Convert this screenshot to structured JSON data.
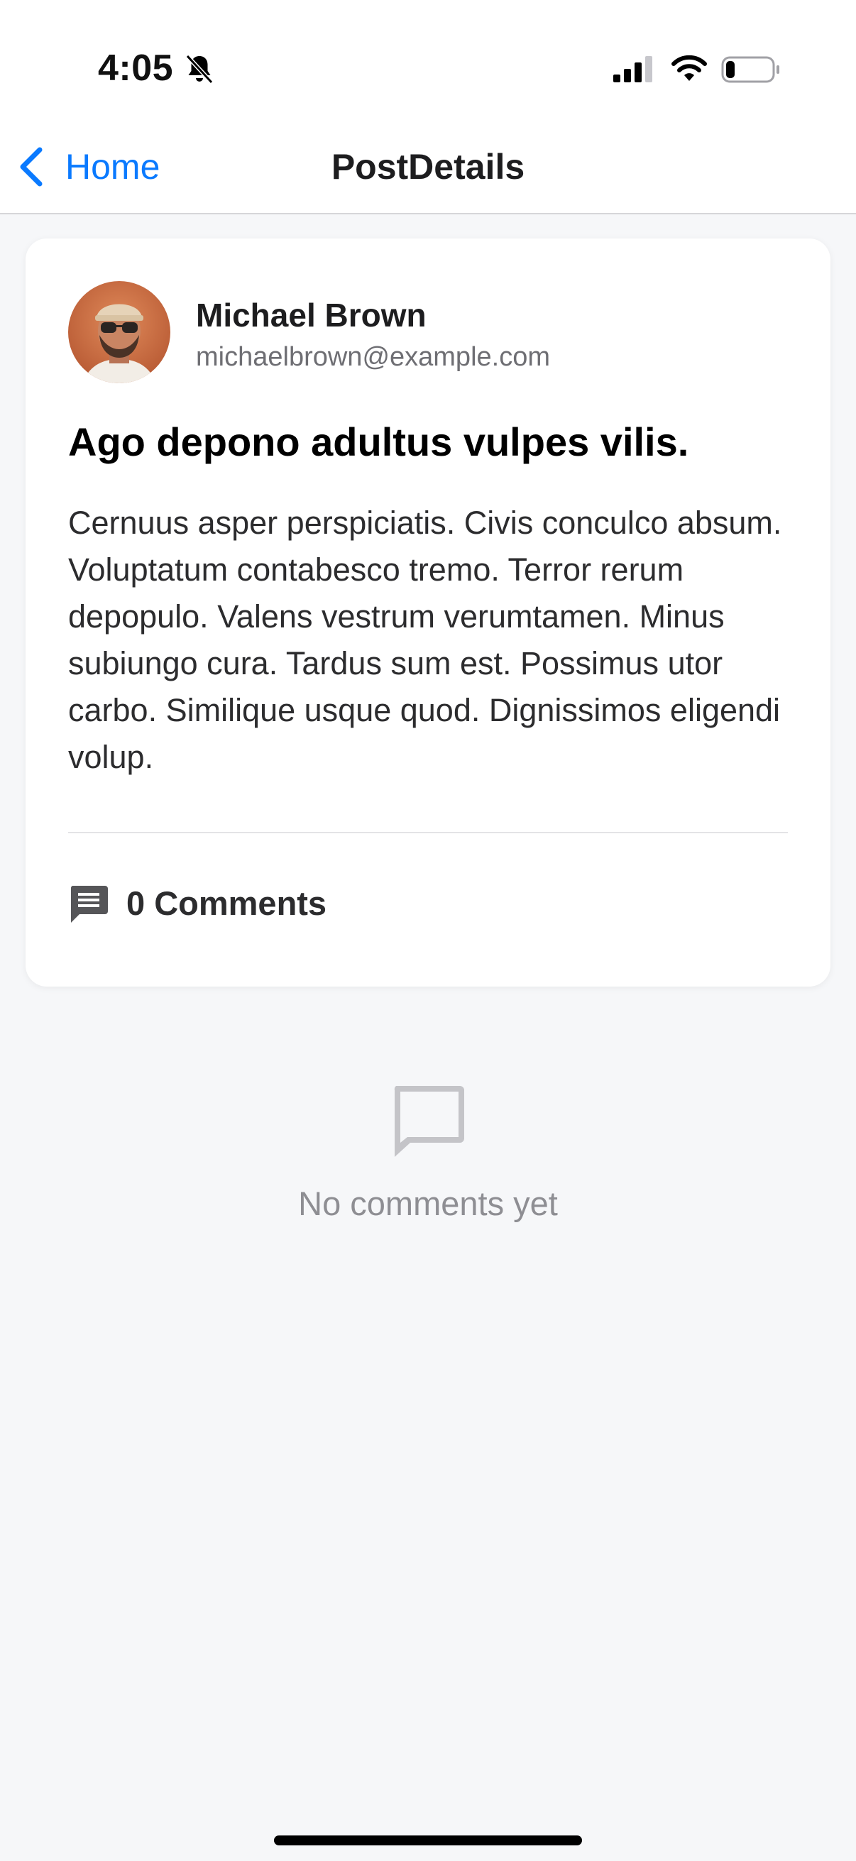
{
  "status_bar": {
    "time": "4:05",
    "icons": [
      "bell-slash-icon",
      "cellular-signal-icon",
      "wifi-icon",
      "battery-icon"
    ],
    "battery_level": 0.2
  },
  "nav": {
    "back_label": "Home",
    "title": "PostDetails"
  },
  "post": {
    "author": {
      "name": "Michael Brown",
      "email": "michaelbrown@example.com"
    },
    "title": "Ago depono adultus vulpes vilis.",
    "body": "Cernuus asper perspiciatis. Civis conculco absum. Voluptatum contabesco tremo. Terror rerum depopulo. Valens vestrum verumtamen. Minus subiungo cura. Tardus sum est. Possimus utor carbo. Similique usque quod. Dignissimos eligendi volup.",
    "comments_label": "0 Comments"
  },
  "empty_state": {
    "message": "No comments yet"
  },
  "colors": {
    "accent": "#0a7aff",
    "background": "#f6f7f9",
    "card": "#ffffff",
    "muted_text": "#8e8e93"
  }
}
